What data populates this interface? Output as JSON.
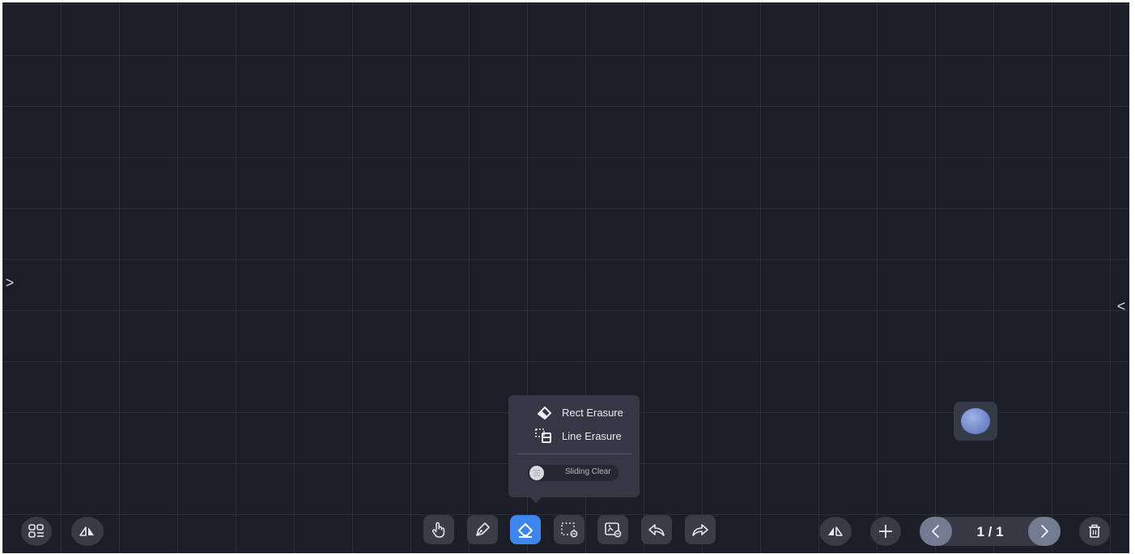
{
  "canvas": {
    "left_toggle": ">",
    "right_toggle": "<"
  },
  "eraser_menu": {
    "items": [
      {
        "label": "Rect Erasure",
        "icon": "rect-eraser-icon"
      },
      {
        "label": "Line Erasure",
        "icon": "line-eraser-icon"
      }
    ],
    "slider_label": "Sliding Clear"
  },
  "toolbar": {
    "left": [
      {
        "icon": "apps-menu-icon"
      },
      {
        "icon": "mirror-icon"
      }
    ],
    "center": [
      {
        "icon": "hand-pointer-icon",
        "active": false
      },
      {
        "icon": "pen-icon",
        "active": false
      },
      {
        "icon": "eraser-icon",
        "active": true
      },
      {
        "icon": "selection-icon",
        "active": false
      },
      {
        "icon": "insert-image-icon",
        "active": false
      },
      {
        "icon": "undo-icon",
        "active": false
      },
      {
        "icon": "redo-icon",
        "active": false
      }
    ],
    "right": [
      {
        "icon": "mirror-icon"
      },
      {
        "icon": "add-page-icon"
      },
      {
        "icon": "delete-icon"
      }
    ]
  },
  "pager": {
    "prev_icon": "chevron-left-icon",
    "next_icon": "chevron-right-icon",
    "text": "1 / 1"
  },
  "colors": {
    "canvas_bg": "#1b1e27",
    "button_bg": "#393d48",
    "accent": "#3d86ee"
  }
}
